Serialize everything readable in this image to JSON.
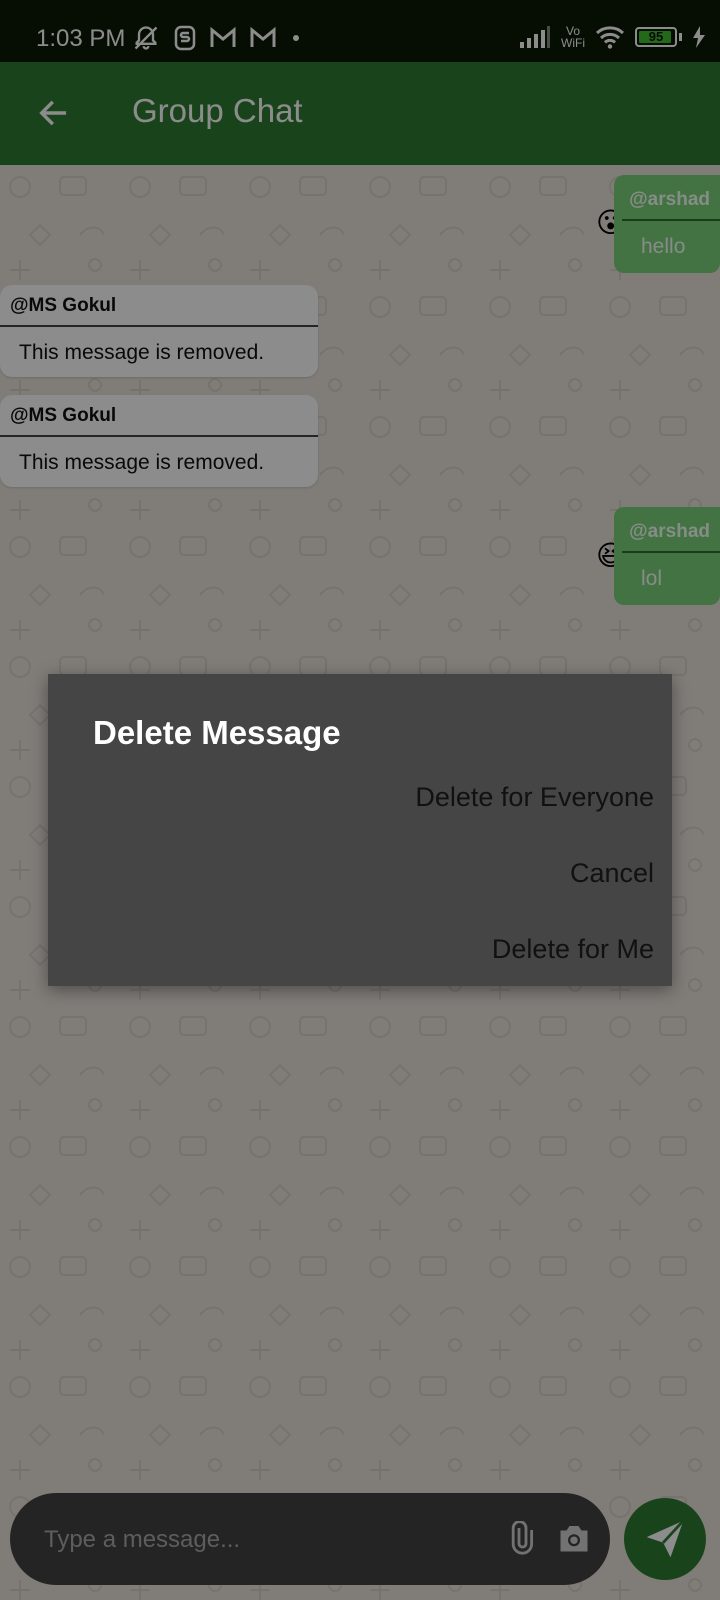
{
  "status_bar": {
    "time": "1:03 PM",
    "vo": "Vo",
    "wifi_label": "WiFi",
    "battery_percent": "95",
    "battery_level": 0.95,
    "icons": [
      "mute-notification-icon",
      "s-app-icon",
      "gmail-icon",
      "gmail-icon",
      "dot-icon",
      "signal-icon",
      "vowifi-icon",
      "wifi-icon",
      "battery-icon",
      "charging-icon"
    ]
  },
  "app_bar": {
    "title": "Group Chat",
    "back_icon": "arrow-left-icon",
    "color": "#2e7d32"
  },
  "messages": [
    {
      "direction": "out",
      "sender": "@arshad",
      "text": "hello",
      "reaction": "😮"
    },
    {
      "direction": "in",
      "sender": "@MS Gokul",
      "text": "This message is removed."
    },
    {
      "direction": "in",
      "sender": "@MS Gokul",
      "text": "This message is removed."
    },
    {
      "direction": "out",
      "sender": "@arshad",
      "text": "lol",
      "reaction": "😆"
    }
  ],
  "input": {
    "placeholder": "Type a message...",
    "attach_icon": "paperclip-icon",
    "camera_icon": "camera-icon",
    "send_icon": "send-icon"
  },
  "dialog": {
    "title": "Delete Message",
    "actions": [
      "Delete for Everyone",
      "Cancel",
      "Delete for Me"
    ]
  },
  "colors": {
    "accent": "#2e7d32",
    "outgoing_bubble": "#7ad27a",
    "dialog_bg": "#454545"
  }
}
